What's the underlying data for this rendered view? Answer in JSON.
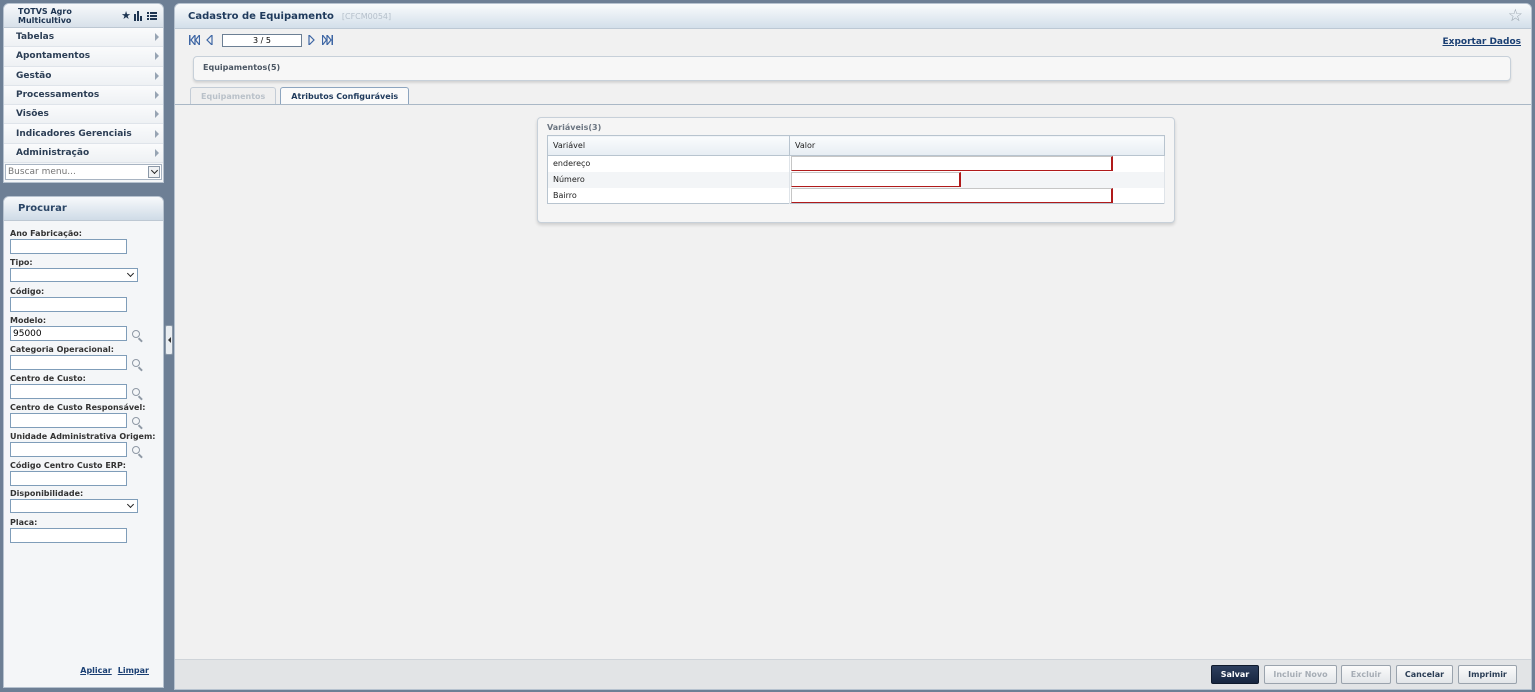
{
  "app": {
    "title": "TOTVS Agro Multicultivo"
  },
  "menu": {
    "items": [
      {
        "label": "Tabelas"
      },
      {
        "label": "Apontamentos"
      },
      {
        "label": "Gestão"
      },
      {
        "label": "Processamentos"
      },
      {
        "label": "Visões"
      },
      {
        "label": "Indicadores Gerenciais"
      },
      {
        "label": "Administração"
      }
    ],
    "search_placeholder": "Buscar menu..."
  },
  "search": {
    "title": "Procurar",
    "fields": [
      {
        "label": "Ano Fabricação:",
        "value": ""
      },
      {
        "label": "Tipo:",
        "value": ""
      },
      {
        "label": "Código:",
        "value": ""
      },
      {
        "label": "Modelo:",
        "value": "95000"
      },
      {
        "label": "Categoria Operacional:",
        "value": ""
      },
      {
        "label": "Centro de Custo:",
        "value": ""
      },
      {
        "label": "Centro de Custo Responsável:",
        "value": ""
      },
      {
        "label": "Unidade Administrativa Origem:",
        "value": ""
      },
      {
        "label": "Código Centro Custo ERP:",
        "value": ""
      },
      {
        "label": "Disponibilidade:",
        "value": ""
      },
      {
        "label": "Placa:",
        "value": ""
      }
    ],
    "apply_label": "Aplicar",
    "clear_label": "Limpar"
  },
  "main": {
    "title": "Cadastro de Equipamento",
    "code": "[CFCM0054]",
    "page_value": "3 / 5",
    "export_label": "Exportar Dados",
    "equipments_label": "Equipamentos(5)",
    "tabs": [
      {
        "label": "Equipamentos"
      },
      {
        "label": "Atributos Configuráveis"
      }
    ],
    "variables": {
      "title": "Variáveis(3)",
      "columns": [
        "Variável",
        "Valor"
      ],
      "rows": [
        {
          "name": "endereço",
          "value": ""
        },
        {
          "name": "Número",
          "value": ""
        },
        {
          "name": "Bairro",
          "value": ""
        }
      ]
    }
  },
  "buttons": {
    "save": "Salvar",
    "new": "Incluir Novo",
    "delete": "Excluir",
    "cancel": "Cancelar",
    "print": "Imprimir"
  },
  "colors": {
    "accent": "#1f3a5c",
    "required_border": "#b01a1a",
    "primary_button": "#1f2e4a"
  }
}
